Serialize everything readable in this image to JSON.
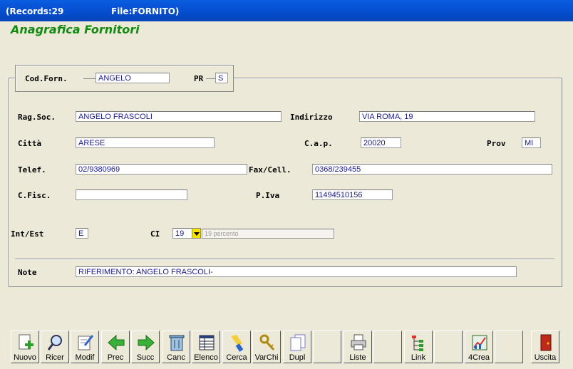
{
  "window": {
    "records": "(Records:29",
    "file": "File:FORNITO)"
  },
  "form": {
    "title": "Anagrafica Fornitori",
    "cod_forn": {
      "label": "Cod.Forn.",
      "value": "ANGELO"
    },
    "pr": {
      "label": "PR",
      "value": "S"
    },
    "rag_soc": {
      "label": "Rag.Soc.",
      "value": "ANGELO FRASCOLI"
    },
    "indirizzo": {
      "label": "Indirizzo",
      "value": "VIA ROMA, 19"
    },
    "citta": {
      "label": "Città",
      "value": "ARESE"
    },
    "cap": {
      "label": "C.a.p.",
      "value": "20020"
    },
    "prov": {
      "label": "Prov",
      "value": "MI"
    },
    "telef": {
      "label": "Telef.",
      "value": "02/9380969"
    },
    "fax": {
      "label": "Fax/Cell.",
      "value": "0368/239455"
    },
    "cfisc": {
      "label": "C.Fisc.",
      "value": ""
    },
    "piva": {
      "label": "P.Iva",
      "value": "11494510156"
    },
    "int_est": {
      "label": "Int/Est",
      "value": "E"
    },
    "ci": {
      "label": "CI",
      "value": "19",
      "description": "19 percento"
    },
    "note": {
      "label": "Note",
      "value": "RIFERIMENTO: ANGELO FRASCOLI-"
    }
  },
  "toolbar": [
    {
      "label": "Nuovo",
      "icon": "new-doc-icon"
    },
    {
      "label": "Ricer",
      "icon": "magnifier-icon"
    },
    {
      "label": "Modif",
      "icon": "edit-doc-icon"
    },
    {
      "label": "Prec",
      "icon": "arrow-left-icon"
    },
    {
      "label": "Succ",
      "icon": "arrow-right-icon"
    },
    {
      "label": "Canc",
      "icon": "trash-icon"
    },
    {
      "label": "Elenco",
      "icon": "table-icon"
    },
    {
      "label": "Cerca",
      "icon": "flashlight-icon"
    },
    {
      "label": "VarChi",
      "icon": "keys-icon"
    },
    {
      "label": "Dupl",
      "icon": "duplicate-icon"
    },
    {
      "label": "",
      "icon": ""
    },
    {
      "label": "Liste",
      "icon": "printer-icon"
    },
    {
      "label": "",
      "icon": ""
    },
    {
      "label": "Link",
      "icon": "tree-icon"
    },
    {
      "label": "",
      "icon": ""
    },
    {
      "label": "4Crea",
      "icon": "chart-create-icon"
    },
    {
      "label": "",
      "icon": ""
    },
    {
      "label": "Uscita",
      "icon": "exit-door-icon"
    }
  ]
}
